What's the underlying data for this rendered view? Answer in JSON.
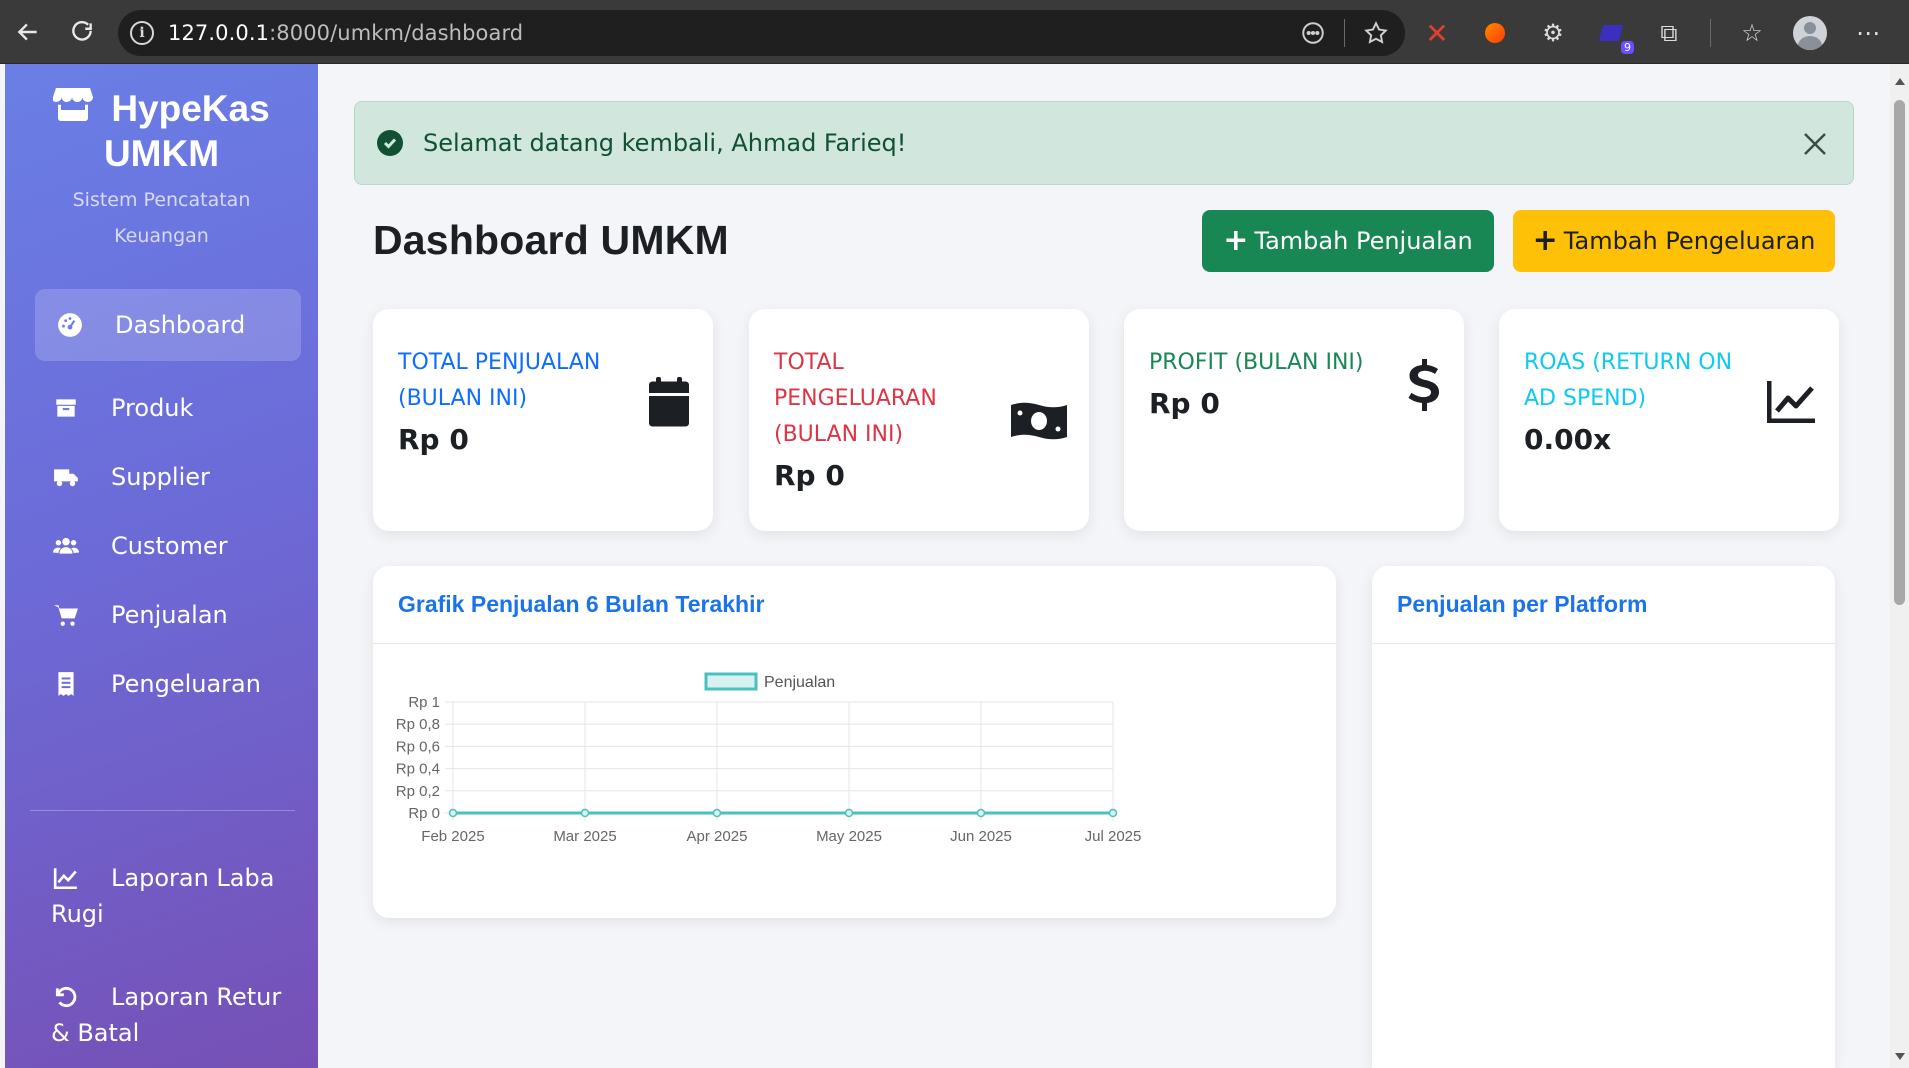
{
  "browser": {
    "url_host": "127.0.0.1",
    "url_path": ":8000/umkm/dashboard",
    "extension_badge": "9"
  },
  "sidebar": {
    "brand_title_line1": "HypeKas",
    "brand_title_line2": "UMKM",
    "brand_subtitle": "Sistem Pencatatan Keuangan",
    "items": [
      {
        "label": "Dashboard",
        "icon": "gauge-icon",
        "active": true
      },
      {
        "label": "Produk",
        "icon": "box-icon"
      },
      {
        "label": "Supplier",
        "icon": "truck-icon"
      },
      {
        "label": "Customer",
        "icon": "users-icon"
      },
      {
        "label": "Penjualan",
        "icon": "cart-icon"
      },
      {
        "label": "Pengeluaran",
        "icon": "receipt-icon"
      }
    ],
    "reports": [
      {
        "label_line1": "Laporan Laba",
        "label_line2": "Rugi",
        "icon": "chart-line-icon"
      },
      {
        "label_line1": "Laporan Retur",
        "label_line2": "& Batal",
        "icon": "undo-icon"
      }
    ]
  },
  "alert": {
    "message": "Selamat datang kembali, Ahmad Farieq!"
  },
  "header": {
    "title": "Dashboard UMKM",
    "add_sale_label": "Tambah Penjualan",
    "add_expense_label": "Tambah Pengeluaran"
  },
  "stats": [
    {
      "label": "TOTAL PENJUALAN (BULAN INI)",
      "value": "Rp 0",
      "color": "#0d6efd",
      "icon": "calendar-icon"
    },
    {
      "label": "TOTAL PENGELUARAN (BULAN INI)",
      "value": "Rp 0",
      "color": "#dc3545",
      "icon": "money-bill-icon"
    },
    {
      "label": "PROFIT (BULAN INI)",
      "value": "Rp 0",
      "color": "#198754",
      "icon": "dollar-icon"
    },
    {
      "label": "ROAS (RETURN ON AD SPEND)",
      "value": "0.00x",
      "color": "#0dcaf0",
      "icon": "chart-line-icon"
    }
  ],
  "sales_chart_card": {
    "title": "Grafik Penjualan 6 Bulan Terakhir"
  },
  "platform_card": {
    "title": "Penjualan per Platform"
  },
  "chart_data": {
    "type": "line",
    "categories": [
      "Feb 2025",
      "Mar 2025",
      "Apr 2025",
      "May 2025",
      "Jun 2025",
      "Jul 2025"
    ],
    "series": [
      {
        "name": "Penjualan",
        "values": [
          0,
          0,
          0,
          0,
          0,
          0
        ],
        "color": "#4bc0c0"
      }
    ],
    "y_ticks": [
      "Rp 0",
      "Rp 0,2",
      "Rp 0,4",
      "Rp 0,6",
      "Rp 0,8",
      "Rp 1"
    ],
    "ylim": [
      0,
      1
    ],
    "grid": true,
    "legend": "top-center"
  }
}
